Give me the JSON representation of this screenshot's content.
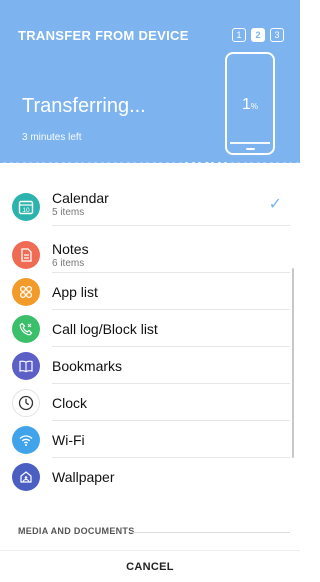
{
  "header": {
    "title": "TRANSFER FROM DEVICE",
    "steps": [
      "1",
      "2",
      "3"
    ],
    "active_step": 2,
    "status": "Transferring...",
    "time_left": "3 minutes left",
    "percent_value": "1",
    "percent_unit": "%"
  },
  "items": [
    {
      "label": "Calendar",
      "sub": "5 items",
      "icon": "calendar-icon",
      "checked": true
    },
    {
      "label": "Notes",
      "sub": "6 items",
      "icon": "notes-icon"
    },
    {
      "label": "App list",
      "icon": "app-list-icon"
    },
    {
      "label": "Call log/Block list",
      "icon": "call-log-icon"
    },
    {
      "label": "Bookmarks",
      "icon": "bookmarks-icon"
    },
    {
      "label": "Clock",
      "icon": "clock-icon"
    },
    {
      "label": "Wi-Fi",
      "icon": "wifi-icon"
    },
    {
      "label": "Wallpaper",
      "icon": "wallpaper-icon"
    }
  ],
  "section": {
    "media_documents": "MEDIA AND DOCUMENTS"
  },
  "footer": {
    "cancel_label": "CANCEL"
  },
  "colors": {
    "accent": "#7db4ef",
    "calendar": "#2db3ad",
    "notes": "#ef6b54",
    "app_list": "#f39b2a",
    "call_log": "#3bbf6b",
    "bookmarks": "#5b5fc6",
    "wifi": "#41a3ea",
    "wallpaper": "#4b5fc3"
  }
}
